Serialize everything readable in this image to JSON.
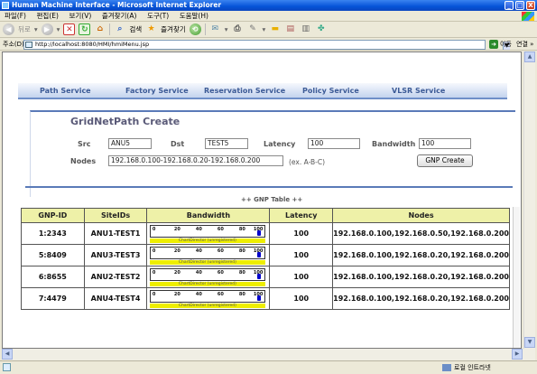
{
  "window": {
    "title": "Human Machine Interface - Microsoft Internet Explorer",
    "min": "_",
    "max": "□",
    "close": "X"
  },
  "menu": [
    "파일(F)",
    "편집(E)",
    "보기(V)",
    "즐겨찾기(A)",
    "도구(T)",
    "도움말(H)"
  ],
  "toolbar": {
    "back": "뒤로",
    "search": "검색",
    "favorites": "즐겨찾기"
  },
  "address": {
    "label": "주소(D)",
    "url": "http://localhost:8080/HMI/hmiMenu.jsp",
    "go": "이동",
    "links": "연결 »"
  },
  "nav": [
    "Path Service",
    "Factory Service",
    "Reservation Service",
    "Policy Service",
    "VLSR Service"
  ],
  "form": {
    "title": "GridNetPath Create",
    "src_label": "Src",
    "src_value": "ANU5",
    "dst_label": "Dst",
    "dst_value": "TEST5",
    "latency_label": "Latency",
    "latency_value": "100",
    "bandwidth_label": "Bandwidth",
    "bandwidth_value": "100",
    "nodes_label": "Nodes",
    "nodes_value": "192.168.0.100-192.168.0.20-192.168.0.200",
    "nodes_hint": "(ex. A-B-C)",
    "create_button": "GNP Create"
  },
  "table": {
    "caption": "++ GNP Table ++",
    "columns": [
      "GNP-ID",
      "SiteIDs",
      "Bandwidth",
      "Latency",
      "Nodes"
    ],
    "gauge_ticks": [
      "0",
      "20",
      "40",
      "60",
      "80",
      "100"
    ],
    "gauge_footer": "ChartDirector (unregistered)",
    "rows": [
      {
        "id": "1:2343",
        "sites": "ANU1-TEST1",
        "bandwidth": 100,
        "latency": "100",
        "nodes": "192.168.0.100,192.168.0.50,192.168.0.200"
      },
      {
        "id": "5:8409",
        "sites": "ANU3-TEST3",
        "bandwidth": 100,
        "latency": "100",
        "nodes": "192.168.0.100,192.168.0.20,192.168.0.200"
      },
      {
        "id": "6:8655",
        "sites": "ANU2-TEST2",
        "bandwidth": 100,
        "latency": "100",
        "nodes": "192.168.0.100,192.168.0.20,192.168.0.200"
      },
      {
        "id": "7:4479",
        "sites": "ANU4-TEST4",
        "bandwidth": 100,
        "latency": "100",
        "nodes": "192.168.0.100,192.168.0.20,192.168.0.200"
      }
    ]
  },
  "status": {
    "zone": "로컬 인트라넷"
  }
}
